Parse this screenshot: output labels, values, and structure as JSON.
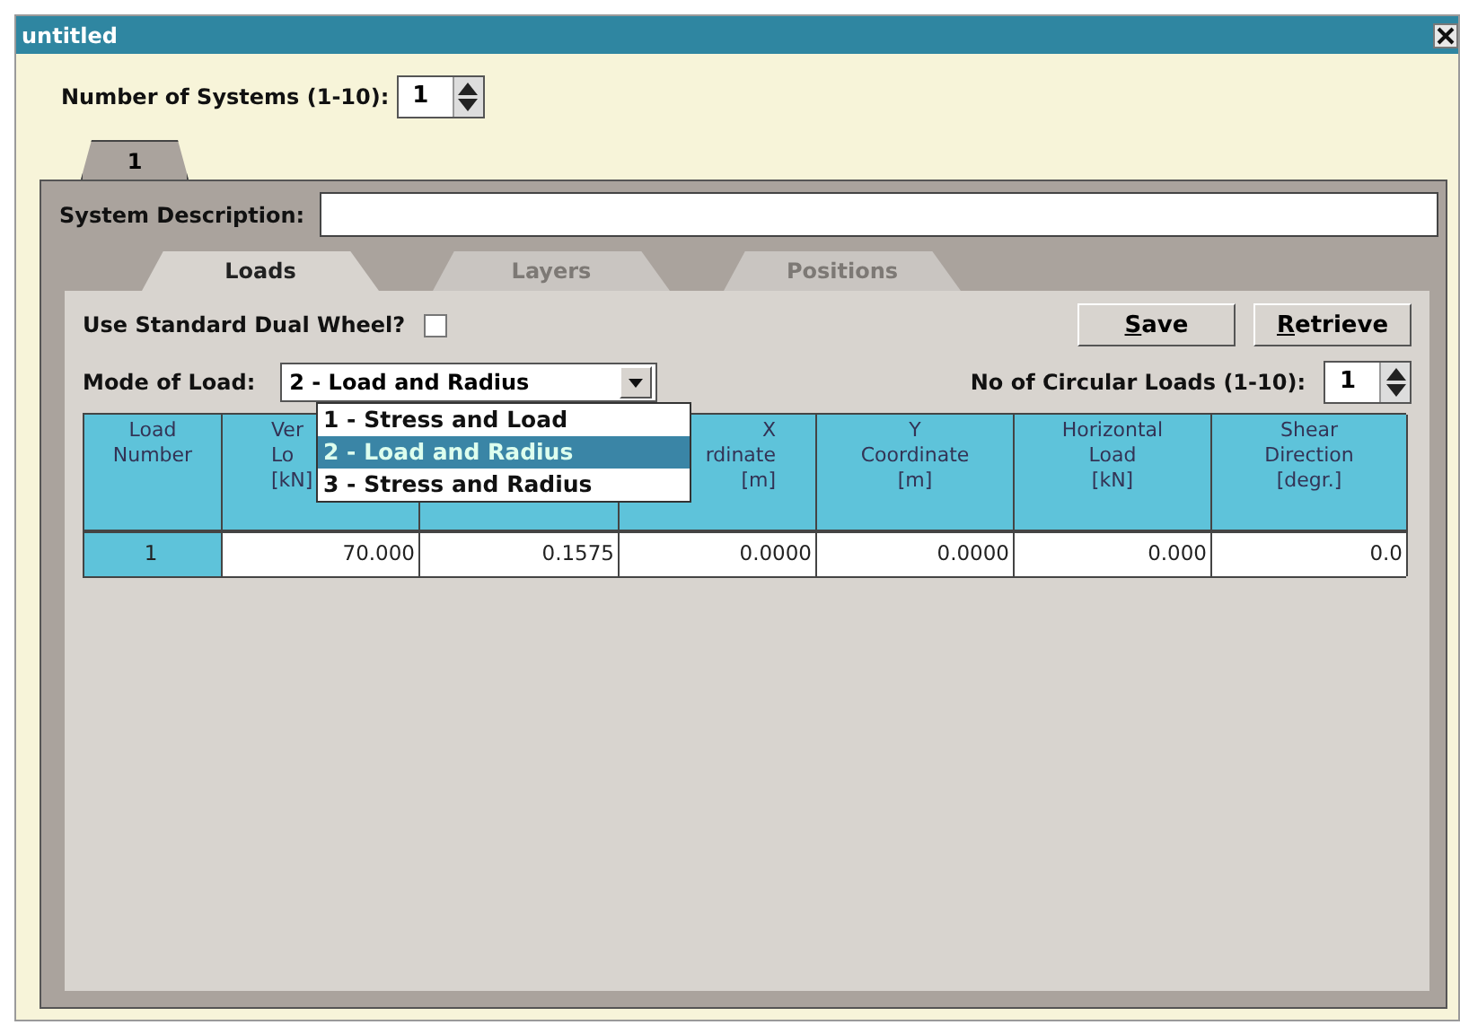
{
  "window": {
    "title": "untitled"
  },
  "systems": {
    "label": "Number of Systems (1-10):",
    "value": "1"
  },
  "system_tabs": [
    {
      "label": "1",
      "selected": true
    }
  ],
  "description": {
    "label": "System Description:"
  },
  "tabs": [
    {
      "label": "Loads",
      "selected": true,
      "disabled": false
    },
    {
      "label": "Layers",
      "selected": false,
      "disabled": true
    },
    {
      "label": "Positions",
      "selected": false,
      "disabled": true
    }
  ],
  "dual_wheel": {
    "label": "Use Standard Dual Wheel?",
    "checked": false
  },
  "buttons": [
    "Save",
    "Retrieve"
  ],
  "mode": {
    "label": "Mode of Load:",
    "value": "2 - Load and Radius",
    "options": [
      {
        "label": "1 - Stress and Load",
        "selected": false
      },
      {
        "label": "2 - Load and Radius",
        "selected": true
      },
      {
        "label": "3 - Stress and Radius",
        "selected": false
      }
    ]
  },
  "circular": {
    "label": "No of Circular Loads (1-10):",
    "value": "1"
  },
  "table": {
    "columns": [
      "Load\nNumber",
      "Ver\nLo\n[kN]",
      "",
      "X\nrdinate\n[m]",
      "Y\nCoordinate\n[m]",
      "Horizontal\nLoad\n[kN]",
      "Shear\nDirection\n[degr.]"
    ],
    "rows": [
      [
        "1",
        "70.000",
        "0.1575",
        "0.0000",
        "0.0000",
        "0.000",
        "0.0"
      ]
    ]
  }
}
